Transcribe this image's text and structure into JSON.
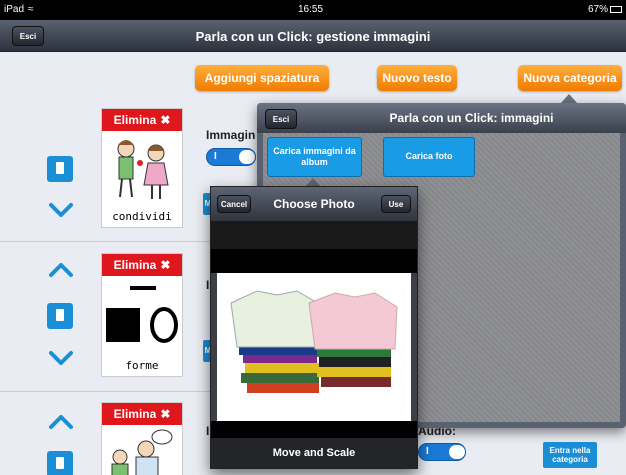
{
  "status": {
    "carrier": "iPad",
    "time": "16:55",
    "battery": "67%"
  },
  "header": {
    "back": "Esci",
    "title": "Parla con un Click: gestione immagini"
  },
  "toolbar": {
    "add_spacing": "Aggiungi spaziatura",
    "new_text": "Nuovo testo",
    "new_category": "Nuova categoria"
  },
  "rows": [
    {
      "delete_label": "Elimina",
      "caption": "condividi",
      "field_label": "Immagin",
      "toggle": "I",
      "side_btn": "M"
    },
    {
      "delete_label": "Elimina",
      "caption": "forme",
      "field_label": "I",
      "side_btn": "M"
    },
    {
      "delete_label": "Elimina",
      "caption": "",
      "field_label": "I",
      "audio_label": "Audio:",
      "toggle": "I",
      "enter_btn": "Entra nella categoria"
    }
  ],
  "images_popover": {
    "back": "Esci",
    "title": "Parla con un Click: immagini",
    "load_album": "Carica immagini da album",
    "load_photo": "Carica foto"
  },
  "photo_chooser": {
    "cancel": "Cancel",
    "title": "Choose Photo",
    "use": "Use",
    "footer": "Move and Scale"
  }
}
